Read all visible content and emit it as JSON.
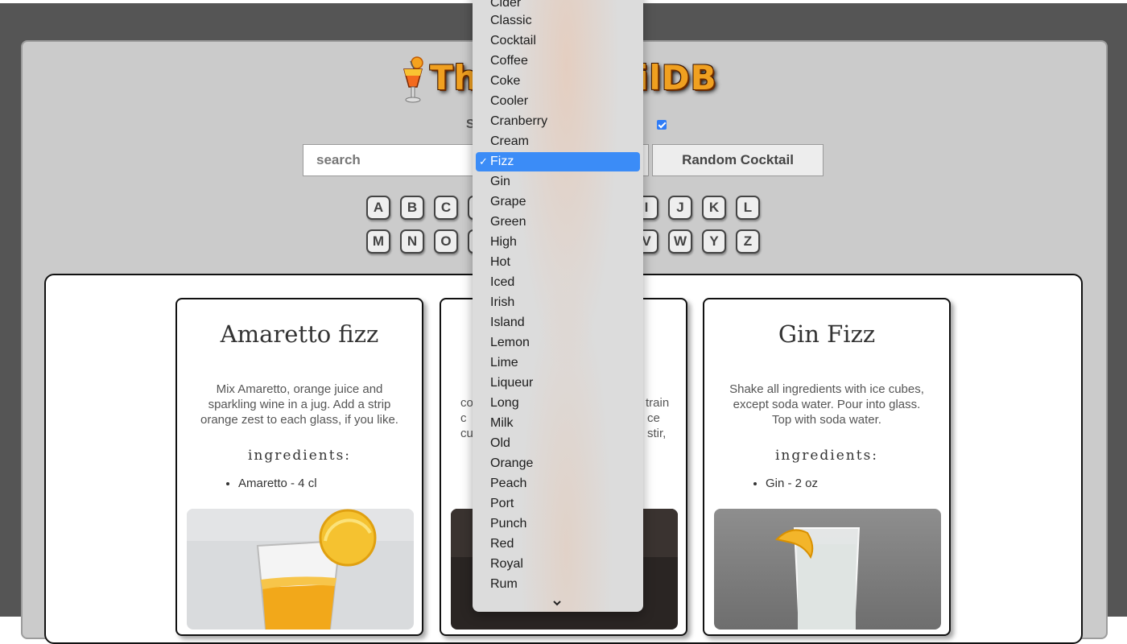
{
  "app": {
    "logo_text_left": "Th",
    "logo_text_right": "ilDB",
    "sub_label": "S"
  },
  "controls": {
    "search_placeholder": "search",
    "random_label": "Random Cocktail",
    "alcoholic_checked": true
  },
  "letters_row1": [
    "A",
    "B",
    "C",
    "I",
    "J",
    "K",
    "L"
  ],
  "letters_row2": [
    "M",
    "N",
    "O",
    "V",
    "W",
    "Y",
    "Z"
  ],
  "dropdown": {
    "items": [
      "Cider",
      "Classic",
      "Cocktail",
      "Coffee",
      "Coke",
      "Cooler",
      "Cranberry",
      "Cream",
      "Fizz",
      "Gin",
      "Grape",
      "Green",
      "High",
      "Hot",
      "Iced",
      "Irish",
      "Island",
      "Lemon",
      "Lime",
      "Liqueur",
      "Long",
      "Milk",
      "Old",
      "Orange",
      "Peach",
      "Port",
      "Punch",
      "Red",
      "Royal",
      "Rum"
    ],
    "selected": "Fizz",
    "check": "✓"
  },
  "cards": [
    {
      "title": "Amaretto fizz",
      "description": "Mix Amaretto, orange juice and sparkling wine in a jug. Add a strip orange zest to each glass, if you like.",
      "ingredients_title": "ingredients:",
      "ingredients": [
        "Amaretto - 4 cl"
      ]
    },
    {
      "desc_fragments": [
        "co",
        "train",
        "c",
        "ce",
        "cu",
        "stir,"
      ]
    },
    {
      "title": "Gin Fizz",
      "description": "Shake all ingredients with ice cubes, except soda water. Pour into glass. Top with soda water.",
      "ingredients_title": "ingredients:",
      "ingredients": [
        "Gin - 2 oz"
      ]
    }
  ]
}
